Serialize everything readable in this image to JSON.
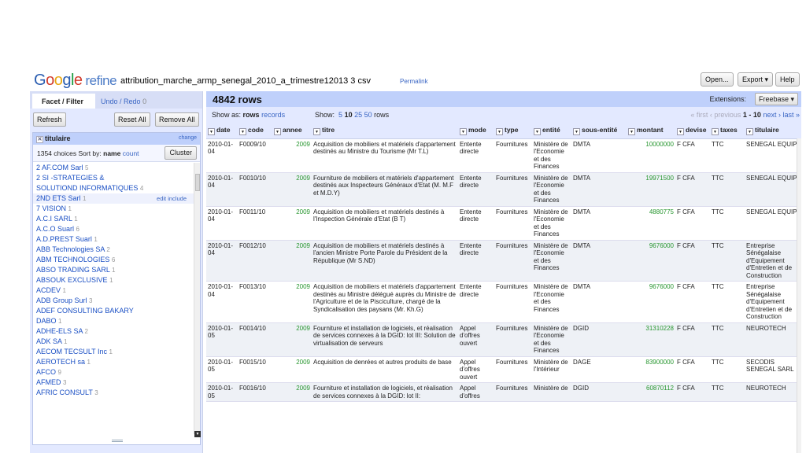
{
  "logo": {
    "google": "Google",
    "refine": "refine"
  },
  "project": {
    "name": "attribution_marche_armp_senegal_2010_a_trimestre12013 3 csv",
    "permalink": "Permalink"
  },
  "header_buttons": {
    "open": "Open...",
    "export": "Export ▾",
    "help": "Help"
  },
  "left_panel": {
    "tab_facet": "Facet / Filter",
    "tab_undo": "Undo / Redo",
    "undo_count": "0",
    "refresh": "Refresh",
    "reset_all": "Reset All",
    "remove_all": "Remove All",
    "facet": {
      "title": "titulaire",
      "change": "change",
      "choices_info": "1354 choices",
      "sort_by": "Sort by:",
      "sort_name": "name",
      "sort_count": "count",
      "cluster": "Cluster",
      "edit": "edit",
      "include": "include",
      "choices": [
        {
          "name": "2 AF.COM Sarl",
          "count": "5"
        },
        {
          "name": "2 SI -STRATEGIES &",
          "count": ""
        },
        {
          "name": "SOLUTIOND INFORMATIQUES",
          "count": "4"
        },
        {
          "name": "2ND ETS Sarl",
          "count": "1"
        },
        {
          "name": "7 VISION",
          "count": "1"
        },
        {
          "name": "A.C.I SARL",
          "count": "1"
        },
        {
          "name": "A.C.O Suarl",
          "count": "6"
        },
        {
          "name": "A.D.PREST Suarl",
          "count": "1"
        },
        {
          "name": "ABB Technologies SA",
          "count": "2"
        },
        {
          "name": "ABM TECHNOLOGIES",
          "count": "6"
        },
        {
          "name": "ABSO TRADING SARL",
          "count": "1"
        },
        {
          "name": "ABSOUK EXCLUSIVE",
          "count": "1"
        },
        {
          "name": "ACDEV",
          "count": "1"
        },
        {
          "name": "ADB Group Surl",
          "count": "3"
        },
        {
          "name": "ADEF CONSULTING BAKARY",
          "count": ""
        },
        {
          "name": "DABO",
          "count": "1"
        },
        {
          "name": "ADHE-ELS SA",
          "count": "2"
        },
        {
          "name": "ADK SA",
          "count": "1"
        },
        {
          "name": "AECOM TECSULT Inc",
          "count": "1"
        },
        {
          "name": "AEROTECH sa",
          "count": "1"
        },
        {
          "name": "AFCO",
          "count": "9"
        },
        {
          "name": "AFMED",
          "count": "3"
        },
        {
          "name": "AFRIC CONSULT",
          "count": "3"
        }
      ]
    }
  },
  "main": {
    "row_count": "4842 rows",
    "extensions_label": "Extensions:",
    "extensions_value": "Freebase ▾",
    "show_as": "Show as:",
    "show_rows": "rows",
    "show_records": "records",
    "show": "Show:",
    "page_sizes": [
      "5",
      "10",
      "25",
      "50"
    ],
    "rows_word": "rows",
    "pager": {
      "first": "« first",
      "previous": "‹ previous",
      "range": "1 - 10",
      "next": "next ›",
      "last": "last »"
    },
    "columns": [
      "date",
      "code",
      "annee",
      "titre",
      "mode",
      "type",
      "entité",
      "sous-entité",
      "montant",
      "devise",
      "taxes",
      "titulaire"
    ],
    "rows": [
      [
        "2010-01-04",
        "F0009/10",
        "2009",
        "Acquisition de mobiliers et matériels d'appartement destinés au Ministre du Tourisme (Mr T.L)",
        "Entente directe",
        "Fournitures",
        "Ministère de l'Economie et des Finances",
        "DMTA",
        "10000000",
        "F CFA",
        "TTC",
        "SENEGAL EQUIP"
      ],
      [
        "2010-01-04",
        "F0010/10",
        "2009",
        "Fourniture de mobiliers et matériels d'appartement destinés aux Inspecteurs Généraux d'Etat (M. M.F et M.D.Y)",
        "Entente directe",
        "Fournitures",
        "Ministère de l'Economie et des Finances",
        "DMTA",
        "19971500",
        "F CFA",
        "TTC",
        "SENEGAL EQUIP"
      ],
      [
        "2010-01-04",
        "F0011/10",
        "2009",
        "Acquisition de mobiliers et matériels destinés à l'Inspection Générale d'Etat (B T)",
        "Entente directe",
        "Fournitures",
        "Ministère de l'Economie et des Finances",
        "DMTA",
        "4880775",
        "F CFA",
        "TTC",
        "SENEGAL EQUIP"
      ],
      [
        "2010-01-04",
        "F0012/10",
        "2009",
        "Acquisition de mobiliers et matériels destinés à l'ancien Ministre Porte Parole du Président de la République (Mr S.ND)",
        "Entente directe",
        "Fournitures",
        "Ministère de l'Economie et des Finances",
        "DMTA",
        "9676000",
        "F CFA",
        "TTC",
        "Entreprise Sénégalaise d'Equipement d'Entretien et de Construction"
      ],
      [
        "2010-01-04",
        "F0013/10",
        "2009",
        "Acquisition de mobiliers et matériels d'appartement destinés au Ministre délégué auprès du Ministre de l'Agriculture et de la Pisciculture, chargé de la Syndicalisation des paysans (Mr. Kh.G)",
        "Entente directe",
        "Fournitures",
        "Ministère de l'Economie et des Finances",
        "DMTA",
        "9676000",
        "F CFA",
        "TTC",
        "Entreprise Sénégalaise d'Equipement d'Entretien et de Construction"
      ],
      [
        "2010-01-05",
        "F0014/10",
        "2009",
        "Fourniture et installation de logiciels, et réalisation de services connexes à la DGID: lot III: Solution de virtualisation de serveurs",
        "Appel d'offres ouvert",
        "Fournitures",
        "Ministère de l'Economie et des Finances",
        "DGID",
        "31310228",
        "F CFA",
        "TTC",
        "NEUROTECH"
      ],
      [
        "2010-01-05",
        "F0015/10",
        "2009",
        "Acquisition de denrées et autres produits de base",
        "Appel d'offres ouvert",
        "Fournitures",
        "Ministère de l'Intérieur",
        "DAGE",
        "83900000",
        "F CFA",
        "TTC",
        "SECODIS SENEGAL SARL"
      ],
      [
        "2010-01-05",
        "F0016/10",
        "2009",
        "Fourniture et installation de logiciels, et réalisation de services connexes à la DGID: lot II:",
        "Appel d'offres",
        "Fournitures",
        "Ministère de",
        "DGID",
        "60870112",
        "F CFA",
        "TTC",
        "NEUROTECH"
      ]
    ]
  }
}
